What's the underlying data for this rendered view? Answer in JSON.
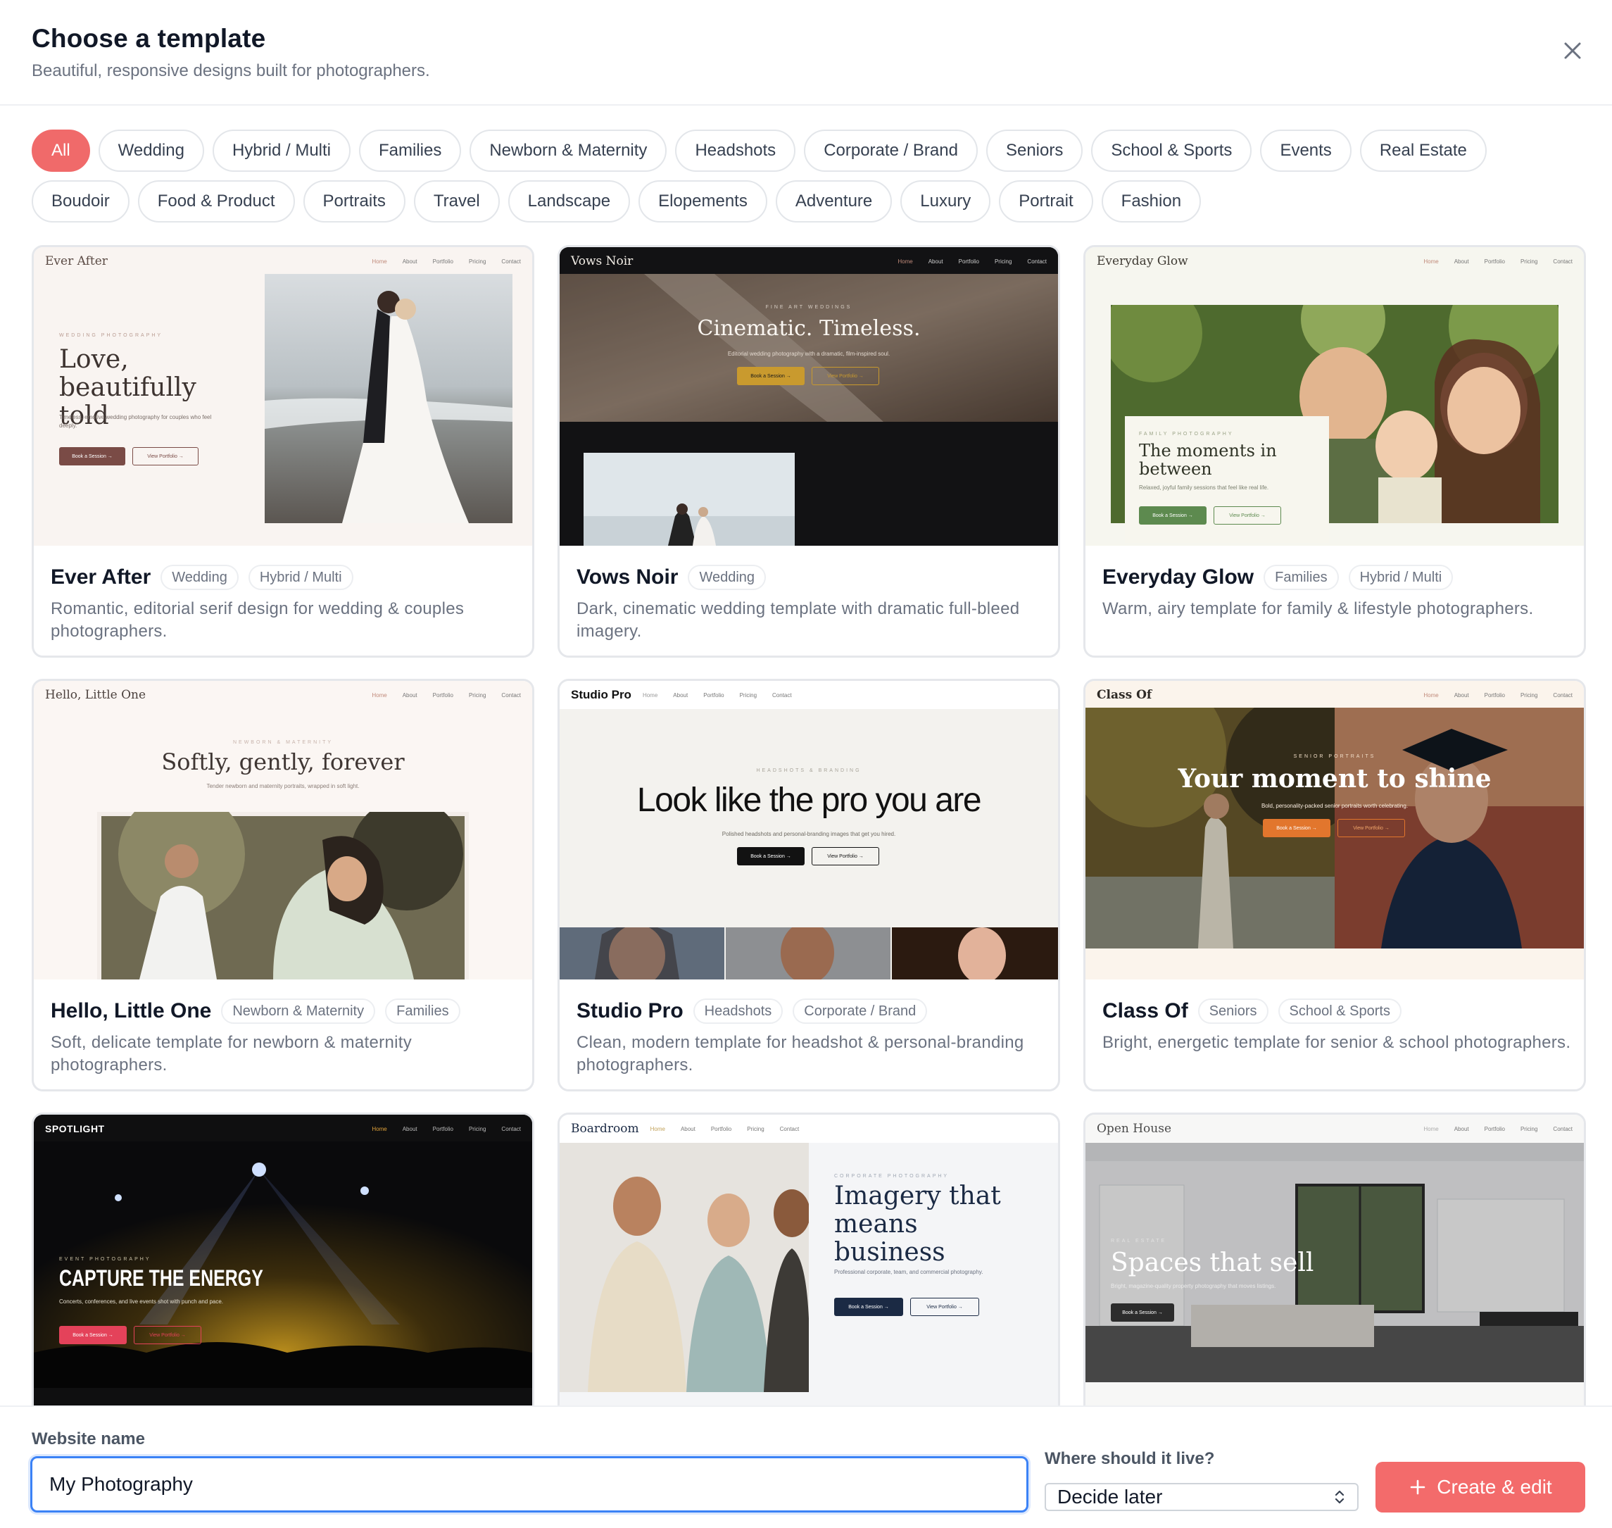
{
  "dialog": {
    "title": "Choose a template",
    "subtitle": "Beautiful, responsive designs built for photographers."
  },
  "filters": [
    "All",
    "Wedding",
    "Hybrid / Multi",
    "Families",
    "Newborn & Maternity",
    "Headshots",
    "Corporate / Brand",
    "Seniors",
    "School & Sports",
    "Events",
    "Real Estate",
    "Boudoir",
    "Food & Product",
    "Portraits",
    "Travel",
    "Landscape",
    "Elopements",
    "Adventure",
    "Luxury",
    "Portrait",
    "Fashion"
  ],
  "active_filter": "All",
  "templates": [
    {
      "name": "Ever After",
      "tags": [
        "Wedding",
        "Hybrid / Multi"
      ],
      "description": "Romantic, editorial serif design for wedding & couples photographers.",
      "preview": {
        "brand": "Ever After",
        "nav": [
          "Home",
          "About",
          "Portfolio",
          "Pricing",
          "Contact"
        ],
        "kicker": "WEDDING PHOTOGRAPHY",
        "headline": "Love, beautifully told",
        "body": "Timeless, emotive wedding photography for couples who feel deeply.",
        "cta1": "Book a Session →",
        "cta2": "View Portfolio →"
      }
    },
    {
      "name": "Vows Noir",
      "tags": [
        "Wedding"
      ],
      "description": "Dark, cinematic wedding template with dramatic full-bleed imagery.",
      "preview": {
        "brand": "Vows Noir",
        "nav": [
          "Home",
          "About",
          "Portfolio",
          "Pricing",
          "Contact"
        ],
        "kicker": "FINE ART WEDDINGS",
        "headline": "Cinematic. Timeless.",
        "body": "Editorial wedding photography with a dramatic, film-inspired soul.",
        "cta1": "Book a Session →",
        "cta2": "View Portfolio →"
      }
    },
    {
      "name": "Everyday Glow",
      "tags": [
        "Families",
        "Hybrid / Multi"
      ],
      "description": "Warm, airy template for family & lifestyle photographers.",
      "preview": {
        "brand": "Everyday Glow",
        "nav": [
          "Home",
          "About",
          "Portfolio",
          "Pricing",
          "Contact"
        ],
        "kicker": "FAMILY PHOTOGRAPHY",
        "headline": "The moments in between",
        "body": "Relaxed, joyful family sessions that feel like real life.",
        "cta1": "Book a Session →",
        "cta2": "View Portfolio →"
      }
    },
    {
      "name": "Hello, Little One",
      "tags": [
        "Newborn & Maternity",
        "Families"
      ],
      "description": "Soft, delicate template for newborn & maternity photographers.",
      "preview": {
        "brand": "Hello, Little One",
        "nav": [
          "Home",
          "About",
          "Portfolio",
          "Pricing",
          "Contact"
        ],
        "kicker": "NEWBORN & MATERNITY",
        "headline": "Softly, gently, forever",
        "body": "Tender newborn and maternity portraits, wrapped in soft light."
      }
    },
    {
      "name": "Studio Pro",
      "tags": [
        "Headshots",
        "Corporate / Brand"
      ],
      "description": "Clean, modern template for headshot & personal-branding photographers.",
      "preview": {
        "brand": "Studio Pro",
        "nav": [
          "Home",
          "About",
          "Portfolio",
          "Pricing",
          "Contact"
        ],
        "kicker": "HEADSHOTS & BRANDING",
        "headline": "Look like the pro you are",
        "body": "Polished headshots and personal-branding images that get you hired.",
        "cta1": "Book a Session →",
        "cta2": "View Portfolio →"
      }
    },
    {
      "name": "Class Of",
      "tags": [
        "Seniors",
        "School & Sports"
      ],
      "description": "Bright, energetic template for senior & school photographers.",
      "preview": {
        "brand": "Class Of",
        "nav": [
          "Home",
          "About",
          "Portfolio",
          "Pricing",
          "Contact"
        ],
        "kicker": "SENIOR PORTRAITS",
        "headline": "Your moment to shine",
        "body": "Bold, personality-packed senior portraits worth celebrating.",
        "cta1": "Book a Session →",
        "cta2": "View Portfolio →"
      }
    },
    {
      "name": "Spotlight",
      "tags": [],
      "description": "",
      "preview": {
        "brand": "SPOTLIGHT",
        "nav": [
          "Home",
          "About",
          "Portfolio",
          "Pricing",
          "Contact"
        ],
        "kicker": "EVENT PHOTOGRAPHY",
        "headline": "CAPTURE THE ENERGY",
        "body": "Concerts, conferences, and live events shot with punch and pace.",
        "cta1": "Book a Session →",
        "cta2": "View Portfolio →"
      }
    },
    {
      "name": "Boardroom",
      "tags": [],
      "description": "",
      "preview": {
        "brand": "Boardroom",
        "nav": [
          "Home",
          "About",
          "Portfolio",
          "Pricing",
          "Contact"
        ],
        "kicker": "CORPORATE PHOTOGRAPHY",
        "headline": "Imagery that means business",
        "body": "Professional corporate, team, and commercial photography.",
        "cta1": "Book a Session →",
        "cta2": "View Portfolio →"
      }
    },
    {
      "name": "Open House",
      "tags": [],
      "description": "",
      "preview": {
        "brand": "Open House",
        "nav": [
          "Home",
          "About",
          "Portfolio",
          "Pricing",
          "Contact"
        ],
        "kicker": "REAL ESTATE",
        "headline": "Spaces that sell",
        "body": "Bright, magazine-quality property photography that moves listings.",
        "cta1": "Book a Session →"
      }
    }
  ],
  "footer": {
    "website_name_label": "Website name",
    "website_name_value": "My Photography",
    "where_label": "Where should it live?",
    "where_value": "Decide later",
    "create_label": "Create & edit"
  },
  "colors": {
    "accent": "#f06a6a",
    "focus": "#3b82f6",
    "border": "#e5e7eb"
  },
  "icons": {
    "close": "close-icon",
    "plus": "plus-icon",
    "select": "chevron-updown-icon"
  }
}
